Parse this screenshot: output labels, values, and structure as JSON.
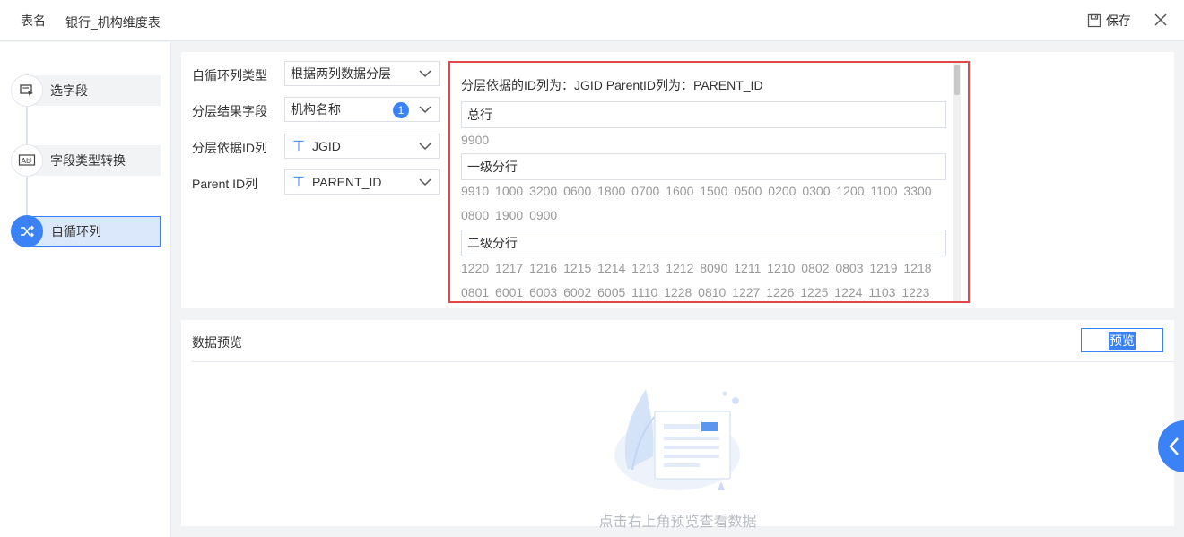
{
  "header": {
    "label": "表名",
    "table_name": "银行_机构维度表",
    "save_label": "保存"
  },
  "sidebar": {
    "steps": [
      {
        "label": "选字段",
        "icon": "select-field-icon"
      },
      {
        "label": "字段类型转换",
        "icon": "type-convert-icon"
      },
      {
        "label": "自循环列",
        "icon": "shuffle-icon",
        "active": true
      }
    ]
  },
  "config": {
    "fields": [
      {
        "label": "自循环列类型",
        "value": "根据两列数据分层"
      },
      {
        "label": "分层结果字段",
        "value": "机构名称",
        "badge": "1"
      },
      {
        "label": "分层依据ID列",
        "value": "JGID"
      },
      {
        "label": "Parent ID列",
        "value": "PARENT_ID"
      }
    ],
    "result": {
      "header": "分层依据的ID列为：JGID  ParentID列为：PARENT_ID",
      "levels": [
        {
          "name": "总行",
          "ids": [
            "9900"
          ]
        },
        {
          "name": "一级分行",
          "ids": [
            "9910 1000 3200 0600 1800 0700 1600 1500 0500 0200 0300 1200 1100 3300",
            "0800 1900 0900"
          ]
        },
        {
          "name": "二级分行",
          "ids": [
            "1220 1217 1216 1215 1214 1213 1212 8090 1211 1210 0802 0803 1219 1218",
            "0801 6001 6003 6002 6005 1110 1228 0810 1227 1226 1225 1224 1103 1223"
          ]
        }
      ]
    }
  },
  "preview": {
    "title": "数据预览",
    "button_label": "预览",
    "empty_text": "点击右上角预览查看数据"
  },
  "colors": {
    "accent": "#3b82f6",
    "highlight_border": "#e34848"
  }
}
